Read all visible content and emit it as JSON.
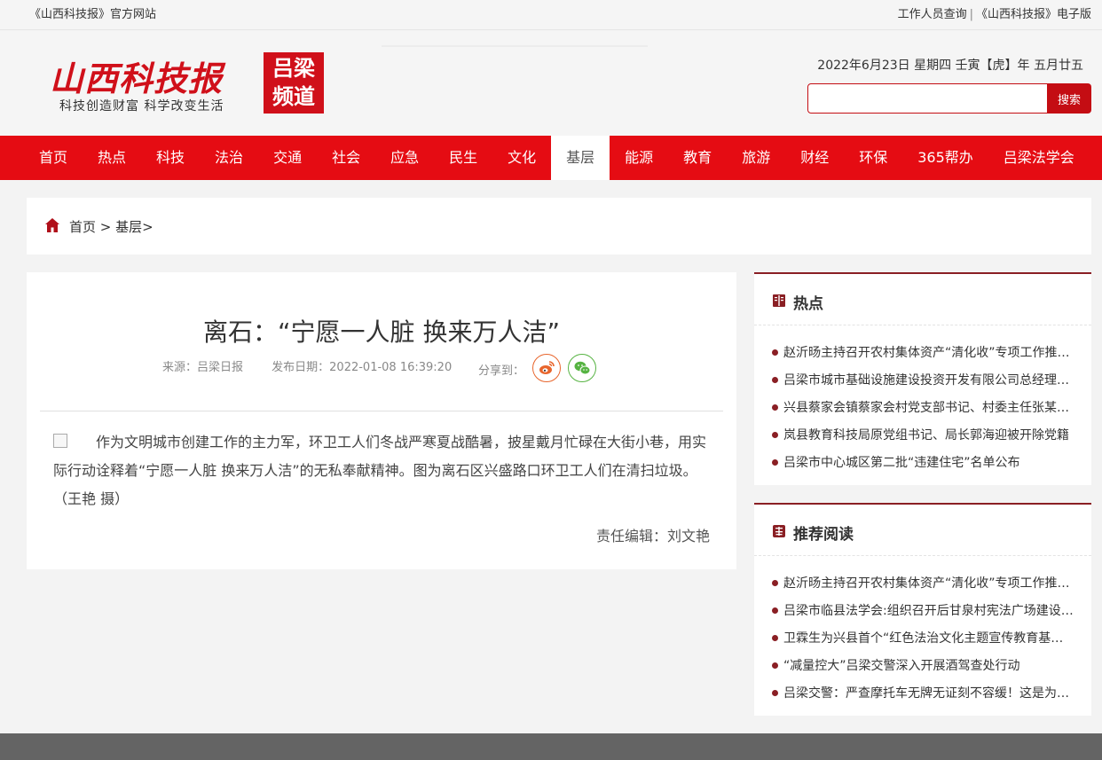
{
  "topbar": {
    "site_label": "《山西科技报》官方网站",
    "staff_query": "工作人员查询",
    "separator": "|",
    "epaper": "《山西科技报》电子版"
  },
  "logo": {
    "name": "山西科技报",
    "slogan": "科技创造财富 科学改变生活",
    "badge_line1": "吕梁",
    "badge_line2": "频道"
  },
  "header": {
    "date": "2022年6月23日 星期四 壬寅【虎】年 五月廿五"
  },
  "search": {
    "placeholder": "",
    "button_label": "搜索"
  },
  "nav": {
    "items": [
      "首页",
      "热点",
      "科技",
      "法治",
      "交通",
      "社会",
      "应急",
      "民生",
      "文化",
      "基层",
      "能源",
      "教育",
      "旅游",
      "财经",
      "环保",
      "365帮办",
      "吕梁法学会"
    ],
    "active": "基层"
  },
  "breadcrumb": {
    "home": "首页",
    "sep1": " > ",
    "current": "基层>"
  },
  "article": {
    "title": "离石：“宁愿一人脏 换来万人洁”",
    "source": "来源：吕梁日报",
    "date": "发布日期：2022-01-08 16:39:20",
    "share_label": "分享到：",
    "body": "作为文明城市创建工作的主力军，环卫工人们冬战严寒夏战酷暑，披星戴月忙碌在大街小巷，用实际行动诠释着“宁愿一人脏 换来万人洁”的无私奉献精神。图为离石区兴盛路口环卫工人们在清扫垃圾。（王艳 摄）",
    "editor": "责任编辑：刘文艳"
  },
  "hot": {
    "title": "热点",
    "items": [
      "赵沂旸主持召开农村集体资产“清化收”专项工作推进会",
      "吕梁市城市基础设施建设投资开发有限公司总经理被查",
      "兴县蔡家会镇蔡家会村党支部书记、村委主任张某被查",
      "岚县教育科技局原党组书记、局长郭海迎被开除党籍",
      "吕梁市中心城区第二批“违建住宅”名单公布"
    ]
  },
  "recommend": {
    "title": "推荐阅读",
    "items": [
      "赵沂旸主持召开农村集体资产“清化收”专项工作推进会",
      "吕梁市临县法学会:组织召开后甘泉村宪法广场建设会议",
      "卫霖生为兴县首个“红色法治文化主题宣传教育基地”揭牌",
      "“减量控大”吕梁交警深入开展酒驾查处行动",
      "吕梁交警：严查摩托车无牌无证刻不容缓！这是为了您的安全"
    ]
  },
  "colors": {
    "brand_red": "#e50c13",
    "dark_red": "#8a1f24",
    "weibo": "#e8652c",
    "wechat": "#56b342"
  }
}
